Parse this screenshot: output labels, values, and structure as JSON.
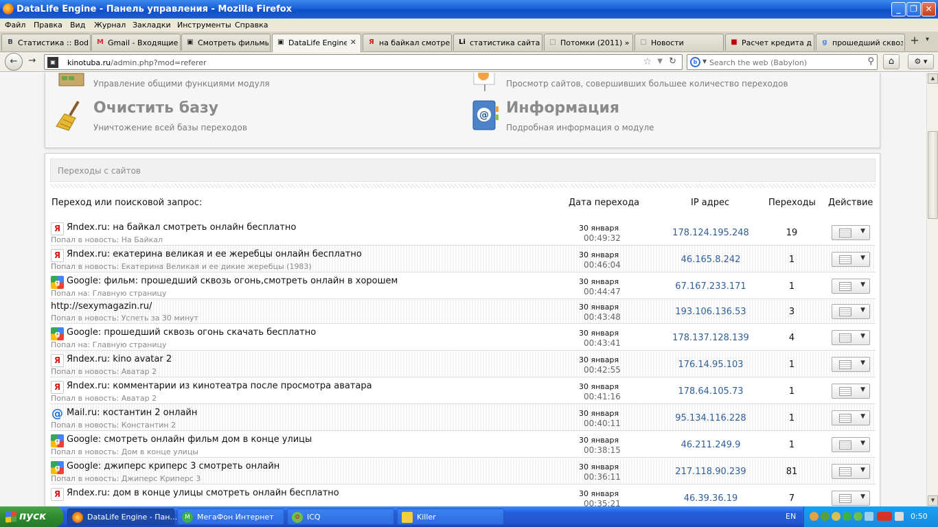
{
  "window": {
    "title": "DataLife Engine - Панель управления - Mozilla Firefox"
  },
  "menu": [
    "Файл",
    "Правка",
    "Вид",
    "Журнал",
    "Закладки",
    "Инструменты",
    "Справка"
  ],
  "tabs": [
    {
      "label": "Статистика :: Bod...",
      "icon": "B"
    },
    {
      "label": "Gmail - Входящие (...",
      "icon": "M"
    },
    {
      "label": "Смотреть фильмы ...",
      "icon": "▣"
    },
    {
      "label": "DataLife Engine ...",
      "icon": "▣",
      "active": true
    },
    {
      "label": "на байкал смотрет...",
      "icon": "Я"
    },
    {
      "label": "статистика сайта ...",
      "icon": "Li"
    },
    {
      "label": "Потомки (2011) » ...",
      "icon": "□"
    },
    {
      "label": "Новости",
      "icon": "□"
    },
    {
      "label": "Расчет кредита д...",
      "icon": "■"
    },
    {
      "label": "прошедший сквоз...",
      "icon": "g"
    }
  ],
  "nav": {
    "url_host": "kinotuba.ru",
    "url_path": "/admin.php?mod=referer",
    "search_placeholder": "Search the web (Babylon)"
  },
  "options": [
    {
      "title": "",
      "desc": "Управление общими функциями модуля",
      "icon": "settings-icon"
    },
    {
      "title": "",
      "desc": "Просмотр сайтов, совершивших большее количество переходов",
      "icon": "chart-icon"
    },
    {
      "title": "Очистить базу",
      "desc": "Уничтожение всей базы переходов",
      "icon": "broom-icon"
    },
    {
      "title": "Информация",
      "desc": "Подробная информация о модуле",
      "icon": "address-book-icon"
    }
  ],
  "panel": {
    "title": "Переходы с сайтов",
    "headers": {
      "source": "Переход или поисковой запрос:",
      "date": "Дата перехода",
      "ip": "IP адрес",
      "count": "Переходы",
      "action": "Действие"
    }
  },
  "rows": [
    {
      "engine": "yandex",
      "source": "Яndex.ru: на байкал смотреть онлайн бесплатно",
      "sub": "Попал в новость: На Байкал",
      "date": "30 января",
      "time": "00:49:32",
      "ip": "178.124.195.248",
      "count": "19"
    },
    {
      "engine": "yandex",
      "source": "Яndex.ru: екатерина великая и ее жеребцы онлайн бесплатно",
      "sub": "Попал в новость: Екатерина Великая и ее дикие жеребцы (1983)",
      "date": "30 января",
      "time": "00:46:04",
      "ip": "46.165.8.242",
      "count": "1"
    },
    {
      "engine": "google",
      "source": "Google: фильм: прошедший сквозь огонь,смотреть онлайн в хорошем",
      "sub": "Попал на: Главную страницу",
      "date": "30 января",
      "time": "00:44:47",
      "ip": "67.167.233.171",
      "count": "1"
    },
    {
      "engine": "none",
      "source": "http://sexymagazin.ru/",
      "sub": "Попал в новость: Успеть за 30 минут",
      "date": "30 января",
      "time": "00:43:48",
      "ip": "193.106.136.53",
      "count": "3"
    },
    {
      "engine": "google",
      "source": "Google: прошедший сквозь огонь скачать бесплатно",
      "sub": "Попал на: Главную страницу",
      "date": "30 января",
      "time": "00:43:41",
      "ip": "178.137.128.139",
      "count": "4"
    },
    {
      "engine": "yandex",
      "source": "Яndex.ru: kino avatar 2",
      "sub": "Попал в новость: Аватар 2",
      "date": "30 января",
      "time": "00:42:55",
      "ip": "176.14.95.103",
      "count": "1"
    },
    {
      "engine": "yandex",
      "source": "Яndex.ru: комментарии из кинотеатра после просмотра аватара",
      "sub": "Попал в новость: Аватар 2",
      "date": "30 января",
      "time": "00:41:16",
      "ip": "178.64.105.73",
      "count": "1"
    },
    {
      "engine": "mail",
      "source": "Mail.ru: костантин 2 онлайн",
      "sub": "Попал в новость: Константин 2",
      "date": "30 января",
      "time": "00:40:11",
      "ip": "95.134.116.228",
      "count": "1"
    },
    {
      "engine": "google",
      "source": "Google: смотреть онлайн фильм дом в конце улицы",
      "sub": "Попал в новость: Дом в конце улицы",
      "date": "30 января",
      "time": "00:38:15",
      "ip": "46.211.249.9",
      "count": "1"
    },
    {
      "engine": "google",
      "source": "Google: джиперс криперс 3 смотреть онлайн",
      "sub": "Попал в новость: Джиперс Криперс 3",
      "date": "30 января",
      "time": "00:36:11",
      "ip": "217.118.90.239",
      "count": "81"
    },
    {
      "engine": "yandex",
      "source": "Яndex.ru: дом в конце улицы смотреть онлайн бесплатно",
      "sub": "",
      "date": "30 января",
      "time": "00:35:21",
      "ip": "46.39.36.19",
      "count": "7"
    }
  ],
  "taskbar": {
    "start": "пуск",
    "tasks": [
      {
        "label": "DataLife Engine - Пан...",
        "active": true
      },
      {
        "label": "МегаФон Интернет",
        "active": false
      },
      {
        "label": "ICQ",
        "active": false
      },
      {
        "label": "Killer",
        "active": false
      }
    ],
    "lang": "EN",
    "clock": "0:50"
  },
  "colors": {
    "link_ip": "#2f5f9a",
    "titlebar": "#1c5fd6",
    "taskbar": "#245edb"
  }
}
